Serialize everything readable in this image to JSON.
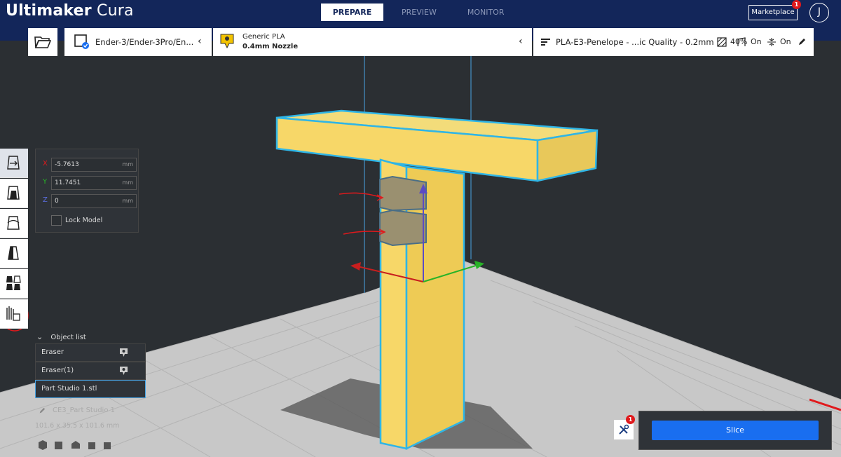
{
  "header": {
    "brand_bold": "Ultimaker",
    "brand_light": "Cura",
    "tabs": [
      {
        "label": "PREPARE",
        "active": true
      },
      {
        "label": "PREVIEW",
        "active": false
      },
      {
        "label": "MONITOR",
        "active": false
      }
    ],
    "marketplace_label": "Marketplace",
    "marketplace_badge": "1",
    "account_initial": "J"
  },
  "toolbar": {
    "printer": "Ender-3/Ender-3Pro/En...",
    "material_name": "Generic PLA",
    "nozzle": "0.4mm Nozzle",
    "profile": "PLA-E3-Penelope - ...ic Quality - 0.2mm",
    "infill": "40%",
    "support": "On",
    "adhesion": "On"
  },
  "side_tools": [
    {
      "name": "move-tool",
      "active": true
    },
    {
      "name": "scale-tool",
      "active": false
    },
    {
      "name": "rotate-tool",
      "active": false
    },
    {
      "name": "mirror-tool",
      "active": false
    },
    {
      "name": "per-model-settings-tool",
      "active": false
    },
    {
      "name": "support-blocker-tool",
      "active": false
    }
  ],
  "move_panel": {
    "x_label": "X",
    "x_value": "-5.7613",
    "y_label": "Y",
    "y_value": "11.7451",
    "z_label": "Z",
    "z_value": "0",
    "unit": "mm",
    "lock_label": "Lock Model"
  },
  "object_list": {
    "header": "Object list",
    "items": [
      {
        "label": "Eraser",
        "selected": false
      },
      {
        "label": "Eraser(1)",
        "selected": false
      },
      {
        "label": "Part Studio 1.stl",
        "selected": true
      }
    ]
  },
  "job": {
    "name": "CE3_Part Studio 1",
    "dimensions": "101.6 x 35.5 x 101.6 mm"
  },
  "actions": {
    "slice_label": "Slice",
    "tools_badge": "1"
  },
  "colors": {
    "header_bg": "#13265a",
    "accent_blue": "#196ef0",
    "model_yellow": "#f7d768",
    "selection_cyan": "#2fb5e6",
    "annotation_red": "#e0191c"
  }
}
